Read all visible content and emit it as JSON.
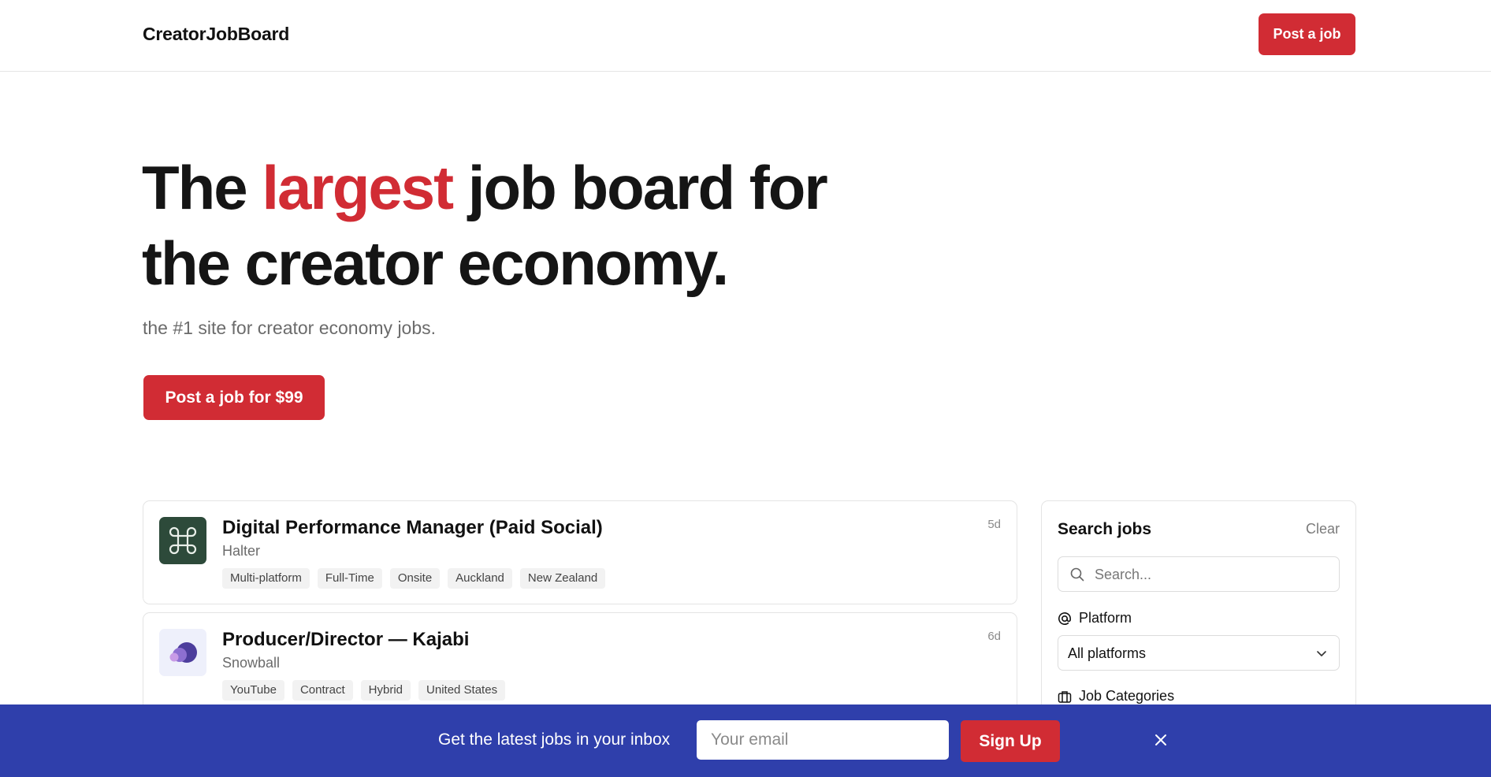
{
  "header": {
    "brand": "CreatorJobBoard",
    "post_button": "Post a job"
  },
  "hero": {
    "title_before": "The ",
    "title_accent": "largest",
    "title_after": " job board for the creator economy.",
    "subtitle": "the #1 site for creator economy jobs.",
    "cta": "Post a job for $99",
    "accent_color": "#d12c34"
  },
  "jobs": [
    {
      "title": "Digital Performance Manager (Paid Social)",
      "company": "Halter",
      "age": "5d",
      "tags": [
        "Multi-platform",
        "Full-Time",
        "Onsite",
        "Auckland",
        "New Zealand"
      ],
      "logo_icon": "command-icon"
    },
    {
      "title": "Producer/Director — Kajabi",
      "company": "Snowball",
      "age": "6d",
      "tags": [
        "YouTube",
        "Contract",
        "Hybrid",
        "United States"
      ],
      "logo_icon": "snowball-logo-icon"
    }
  ],
  "search": {
    "title": "Search jobs",
    "clear": "Clear",
    "placeholder": "Search...",
    "platform_label": "Platform",
    "platform_value": "All platforms",
    "categories_label": "Job Categories"
  },
  "signup": {
    "text": "Get the latest jobs in your inbox",
    "email_placeholder": "Your email",
    "button": "Sign Up",
    "bar_color": "#2f3fab"
  }
}
